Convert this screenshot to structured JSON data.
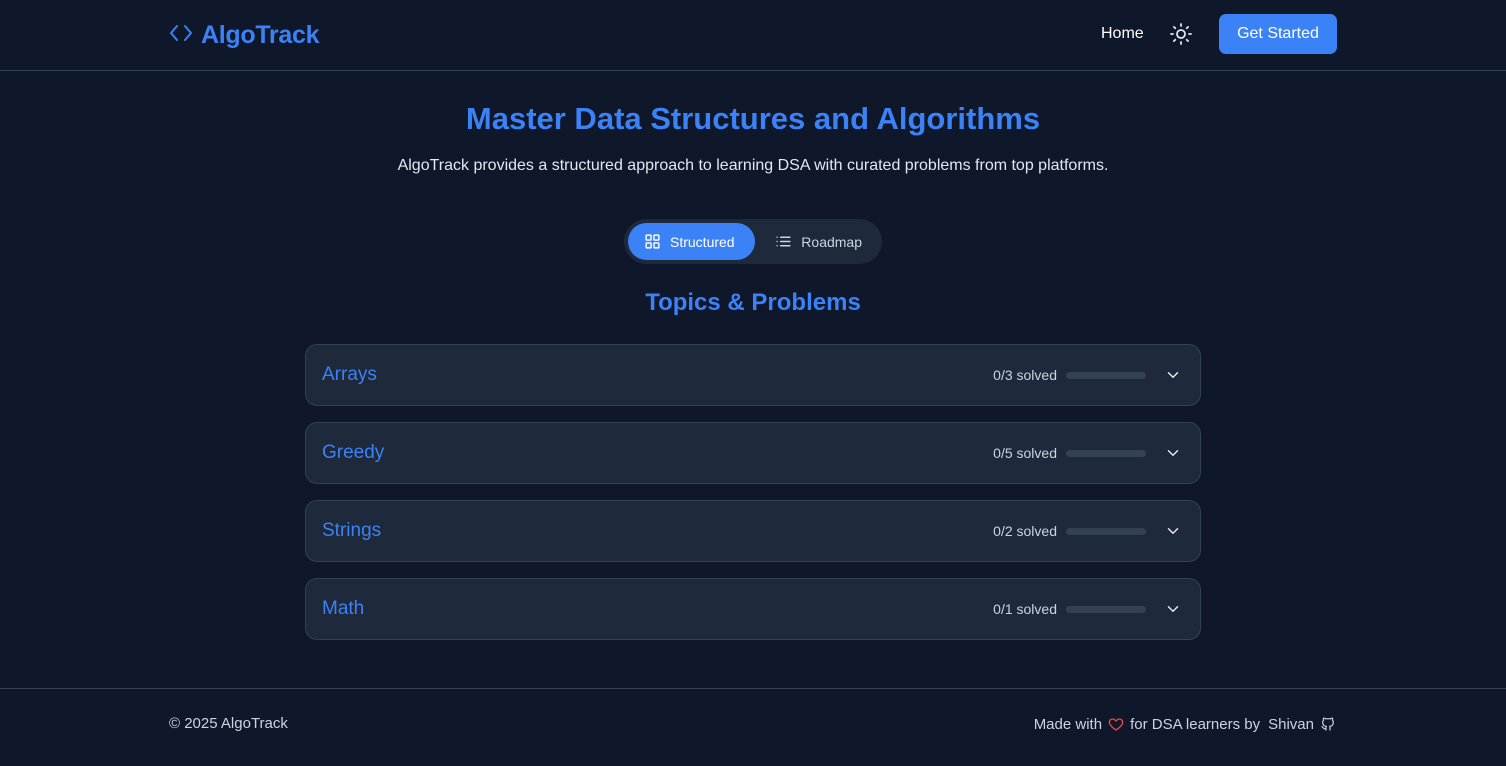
{
  "header": {
    "logo_text": "AlgoTrack",
    "nav_home": "Home",
    "cta_label": "Get Started"
  },
  "hero": {
    "title": "Master Data Structures and Algorithms",
    "subtitle": "AlgoTrack provides a structured approach to learning DSA with curated problems from top platforms."
  },
  "view_toggle": {
    "structured_label": "Structured",
    "roadmap_label": "Roadmap",
    "active": "Structured"
  },
  "section_title": "Topics & Problems",
  "topics": [
    {
      "name": "Arrays",
      "solved_text": "0/3 solved",
      "progress": 0
    },
    {
      "name": "Greedy",
      "solved_text": "0/5 solved",
      "progress": 0
    },
    {
      "name": "Strings",
      "solved_text": "0/2 solved",
      "progress": 0
    },
    {
      "name": "Math",
      "solved_text": "0/1 solved",
      "progress": 0
    }
  ],
  "footer": {
    "copyright": "© 2025 AlgoTrack",
    "made_with": "Made with",
    "for_text": "for DSA learners by",
    "author": "Shivan"
  },
  "icons": {
    "logo": "code-brackets-icon",
    "theme": "sun-icon",
    "structured": "grid-icon",
    "roadmap": "list-icon",
    "expand": "chevron-down-icon",
    "heart": "heart-icon",
    "github": "github-icon"
  },
  "colors": {
    "background": "#0f172a",
    "surface": "#1e293b",
    "border": "#334155",
    "accent": "#3b82f6",
    "heart": "#ef4444"
  }
}
